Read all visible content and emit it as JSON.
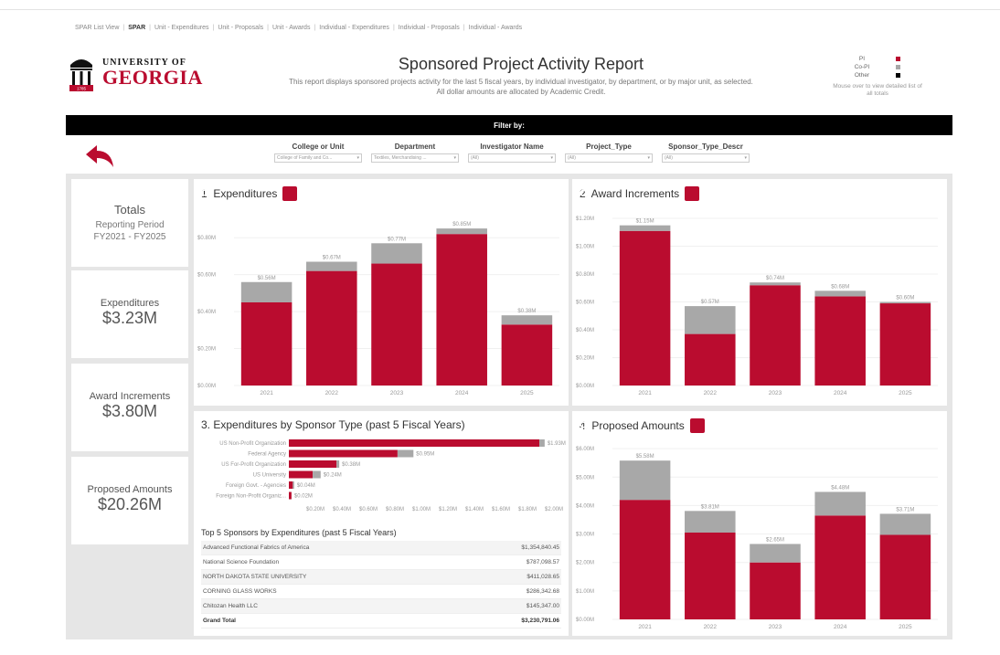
{
  "nav": [
    {
      "label": "SPAR List View",
      "active": false
    },
    {
      "label": "SPAR",
      "active": true
    },
    {
      "label": "Unit - Expenditures",
      "active": false
    },
    {
      "label": "Unit - Proposals",
      "active": false
    },
    {
      "label": "Unit - Awards",
      "active": false
    },
    {
      "label": "Individual - Expenditures",
      "active": false
    },
    {
      "label": "Individual - Proposals",
      "active": false
    },
    {
      "label": "Individual - Awards",
      "active": false
    }
  ],
  "logo": {
    "line1": "UNIVERSITY OF",
    "line2": "GEORGIA",
    "year": "1785"
  },
  "header": {
    "title": "Sponsored Project Activity Report",
    "desc1": "This report displays sponsored projects activity for the last 5 fiscal years, by individual investigator, by department, or by major unit, as selected.",
    "desc2": "All dollar amounts are allocated by Academic Credit."
  },
  "legend": {
    "items": [
      {
        "label": "PI",
        "color": "#ba0c2f"
      },
      {
        "label": "Co-PI",
        "color": "#a8a8a8"
      },
      {
        "label": "Other",
        "color": "#000000"
      }
    ],
    "note": "Mouse over to view detailed list of all totals"
  },
  "filterbar": {
    "label": "Filter by:"
  },
  "filters": [
    {
      "label": "College or Unit",
      "value": "College of Family and Co...",
      "width": 96
    },
    {
      "label": "Department",
      "value": "Textiles, Merchandising ...",
      "width": 96
    },
    {
      "label": "Investigator Name",
      "value": "(All)",
      "width": 96
    },
    {
      "label": "Project_Type",
      "value": "(All)",
      "width": 96
    },
    {
      "label": "Sponsor_Type_Descr",
      "value": "(All)",
      "width": 96
    }
  ],
  "sidebar": {
    "totals_title": "Totals",
    "period_label": "Reporting Period",
    "period_value": "FY2021 - FY2025",
    "expenditures_label": "Expenditures",
    "expenditures_value": "$3.23M",
    "awards_label": "Award Increments",
    "awards_value": "$3.80M",
    "proposed_label": "Proposed Amounts",
    "proposed_value": "$20.26M"
  },
  "panels": {
    "expenditures": "1. Expenditures",
    "awards": "2. Award Increments",
    "sponsor_type": "3. Expenditures by Sponsor Type (past 5 Fiscal Years)",
    "proposed": "4. Proposed Amounts"
  },
  "top5": {
    "title": "Top 5 Sponsors by Expenditures (past 5 Fiscal Years)",
    "rows": [
      {
        "name": "Advanced Functional Fabrics of America",
        "value": "$1,354,840.45"
      },
      {
        "name": "National Science Foundation",
        "value": "$787,098.57"
      },
      {
        "name": "NORTH DAKOTA STATE UNIVERSITY",
        "value": "$411,028.65"
      },
      {
        "name": "CORNING GLASS WORKS",
        "value": "$286,342.68"
      },
      {
        "name": "Chitozan Health LLC",
        "value": "$145,347.00"
      }
    ],
    "total_label": "Grand Total",
    "total_value": "$3,230,791.06"
  },
  "colors": {
    "pi": "#ba0c2f",
    "copi": "#a8a8a8",
    "text": "#999999"
  },
  "chart_data": [
    {
      "type": "bar",
      "title": "1. Expenditures",
      "categories": [
        "2021",
        "2022",
        "2023",
        "2024",
        "2025"
      ],
      "series": [
        {
          "name": "PI",
          "values": [
            0.45,
            0.62,
            0.66,
            0.82,
            0.33
          ]
        },
        {
          "name": "Co-PI",
          "values": [
            0.11,
            0.05,
            0.11,
            0.03,
            0.05
          ]
        }
      ],
      "totals": [
        "$0.56M",
        "$0.67M",
        "$0.77M",
        "$0.85M",
        "$0.38M"
      ],
      "yticks": [
        "$0.00M",
        "$0.20M",
        "$0.40M",
        "$0.60M",
        "$0.80M"
      ],
      "ylim": [
        0,
        0.9
      ]
    },
    {
      "type": "bar",
      "title": "2. Award Increments",
      "categories": [
        "2021",
        "2022",
        "2023",
        "2024",
        "2025"
      ],
      "series": [
        {
          "name": "PI",
          "values": [
            1.11,
            0.37,
            0.72,
            0.64,
            0.59
          ]
        },
        {
          "name": "Co-PI",
          "values": [
            0.04,
            0.2,
            0.02,
            0.04,
            0.01
          ]
        }
      ],
      "totals": [
        "$1.15M",
        "$0.57M",
        "$0.74M",
        "$0.68M",
        "$0.60M"
      ],
      "yticks": [
        "$0.00M",
        "$0.20M",
        "$0.40M",
        "$0.60M",
        "$0.80M",
        "$1.00M",
        "$1.20M"
      ],
      "ylim": [
        0,
        1.22
      ]
    },
    {
      "type": "bar",
      "orientation": "horizontal",
      "title": "3. Expenditures by Sponsor Type (past 5 Fiscal Years)",
      "categories": [
        "US Non-Profit Organization",
        "Federal Agency",
        "US For-Profit Organization",
        "US University",
        "Foreign Govt. - Agencies",
        "Foreign Non-Profit Organiz..."
      ],
      "series": [
        {
          "name": "PI",
          "values": [
            1.89,
            0.82,
            0.36,
            0.18,
            0.03,
            0.02
          ]
        },
        {
          "name": "Co-PI",
          "values": [
            0.04,
            0.12,
            0.02,
            0.06,
            0.01,
            0.0
          ]
        }
      ],
      "labels": [
        "$1.93M",
        "$0.95M",
        "$0.38M",
        "$0.24M",
        "$0.04M",
        "$0.02M"
      ],
      "xticks": [
        "$0.20M",
        "$0.40M",
        "$0.60M",
        "$0.80M",
        "$1.00M",
        "$1.20M",
        "$1.40M",
        "$1.60M",
        "$1.80M",
        "$2.00M"
      ],
      "xlim": [
        0,
        2.0
      ]
    },
    {
      "type": "bar",
      "title": "4. Proposed Amounts",
      "categories": [
        "2021",
        "2022",
        "2023",
        "2024",
        "2025"
      ],
      "series": [
        {
          "name": "PI",
          "values": [
            4.2,
            3.05,
            2.0,
            3.65,
            2.97
          ]
        },
        {
          "name": "Co-PI",
          "values": [
            1.38,
            0.76,
            0.65,
            0.83,
            0.74
          ]
        }
      ],
      "totals": [
        "$5.58M",
        "$3.81M",
        "$2.65M",
        "$4.48M",
        "$3.71M"
      ],
      "yticks": [
        "$0.00M",
        "$1.00M",
        "$2.00M",
        "$3.00M",
        "$4.00M",
        "$5.00M",
        "$6.00M"
      ],
      "ylim": [
        0,
        6.1
      ]
    }
  ]
}
